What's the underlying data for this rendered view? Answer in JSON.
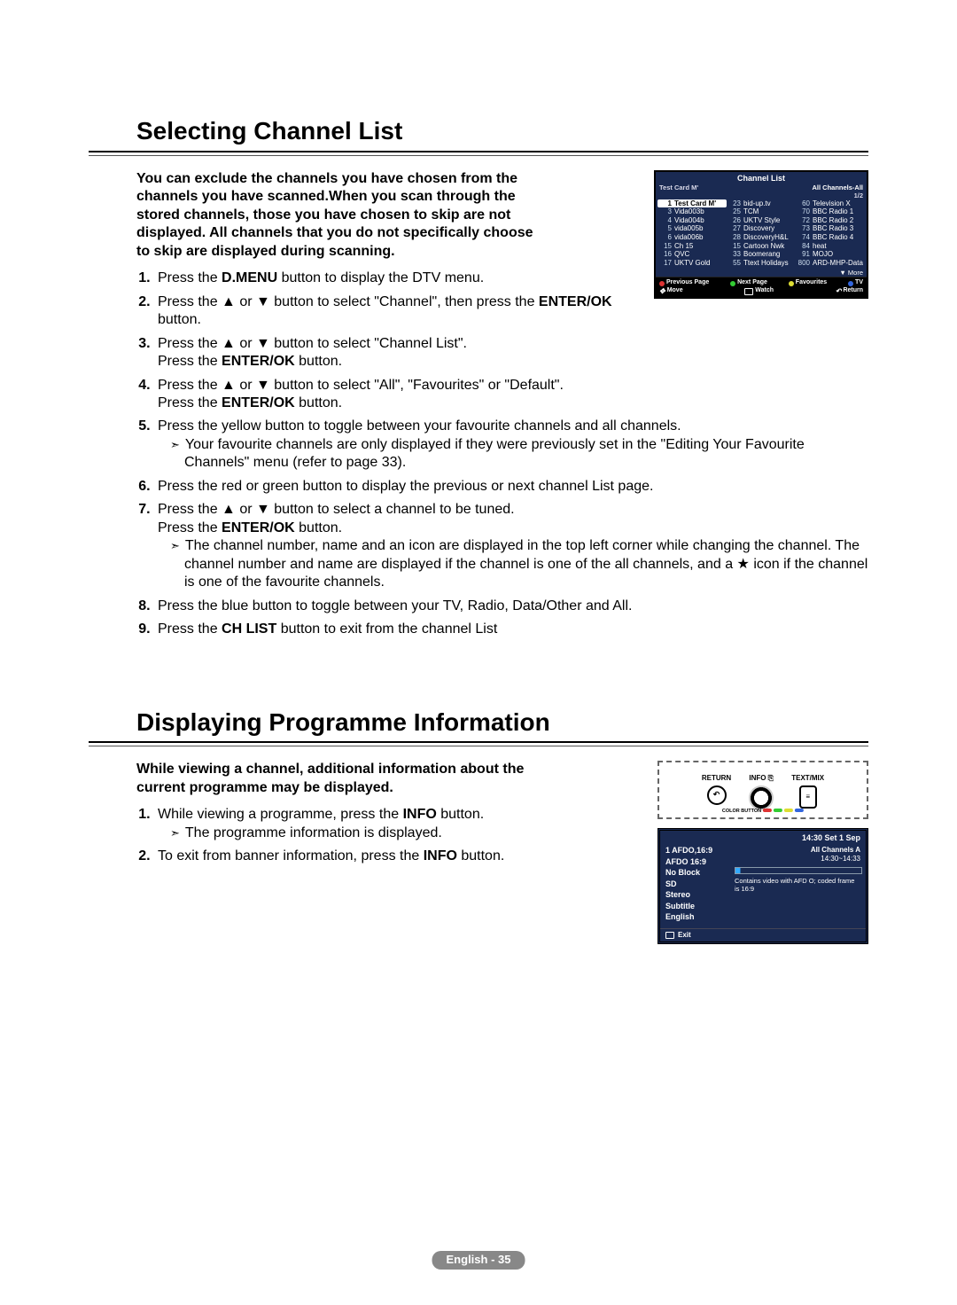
{
  "section1": {
    "title": "Selecting Channel List",
    "intro": "You can exclude the channels you have chosen from the channels you have scanned.When you scan through the stored channels, those you have chosen to skip are not displayed. All channels that you do not specifically choose to skip are displayed during scanning.",
    "steps": {
      "s1a": "Press the ",
      "s1b": "D.MENU",
      "s1c": " button to display the DTV menu.",
      "s2a": "Press the ▲ or ▼ button to select \"Channel\", then press the ",
      "s2b": "ENTER/OK",
      "s2c": " button.",
      "s3a": "Press the ▲ or ▼ button to select \"Channel List\".",
      "s3b": "Press the ",
      "s3c": "ENTER/OK",
      "s3d": " button.",
      "s4a": "Press the ▲ or ▼ button to select \"All\", \"Favourites\" or \"Default\".",
      "s4b": "Press the ",
      "s4c": "ENTER/OK",
      "s4d": " button.",
      "s5a": "Press the yellow button to toggle between your favourite channels and all channels.",
      "s5sub": "Your favourite channels are only displayed if they were previously set in the \"Editing Your Favourite Channels\" menu (refer to page 33).",
      "s6": "Press the red or green button to display the previous or next channel List page.",
      "s7a": "Press the ▲ or ▼ button to select a channel to be tuned.",
      "s7b": "Press the ",
      "s7c": "ENTER/OK",
      "s7d": " button.",
      "s7sub": "The channel number, name and an icon are displayed in the top left corner while changing the channel. The channel number and name are displayed if the channel is one of the all channels, and a ★ icon if the channel is one of the favourite channels.",
      "s8": "Press the blue button to toggle between your TV, Radio, Data/Other and All.",
      "s9a": "Press the ",
      "s9b": "CH LIST",
      "s9c": " button to exit from the channel List"
    }
  },
  "osd": {
    "title": "Channel List",
    "subLeft": "Test Card M'",
    "subRight": "All Channels-All",
    "page": "1/2",
    "col1": [
      {
        "n": "1",
        "name": "Test Card M'",
        "hl": true
      },
      {
        "n": "3",
        "name": "Vida003b"
      },
      {
        "n": "4",
        "name": "Vida004b"
      },
      {
        "n": "5",
        "name": "vida005b"
      },
      {
        "n": "6",
        "name": "vida006b"
      },
      {
        "n": "15",
        "name": "Ch 15"
      },
      {
        "n": "16",
        "name": "QVC"
      },
      {
        "n": "17",
        "name": "UKTV Gold"
      }
    ],
    "col2": [
      {
        "n": "23",
        "name": "bid-up.tv"
      },
      {
        "n": "25",
        "name": "TCM"
      },
      {
        "n": "26",
        "name": "UKTV Style"
      },
      {
        "n": "27",
        "name": "Discovery"
      },
      {
        "n": "28",
        "name": "DiscoveryH&L"
      },
      {
        "n": "15",
        "name": "Cartoon Nwk"
      },
      {
        "n": "33",
        "name": "Boomerang"
      },
      {
        "n": "55",
        "name": "Ttext Holidays"
      }
    ],
    "col3": [
      {
        "n": "60",
        "name": "Television X"
      },
      {
        "n": "70",
        "name": "BBC Radio 1"
      },
      {
        "n": "72",
        "name": "BBC Radio 2"
      },
      {
        "n": "73",
        "name": "BBC Radio 3"
      },
      {
        "n": "74",
        "name": "BBC Radio 4"
      },
      {
        "n": "84",
        "name": "heat"
      },
      {
        "n": "91",
        "name": "MOJO"
      },
      {
        "n": "800",
        "name": "ARD-MHP-Data"
      }
    ],
    "more": "▼ More",
    "legend": {
      "prev": "Previous Page",
      "next": "Next Page",
      "fav": "Favourites",
      "tv": "TV",
      "move": "Move",
      "watch": "Watch",
      "ret": "Return"
    }
  },
  "section2": {
    "title": "Displaying Programme Information",
    "intro": "While viewing a channel, additional information about the current programme may be displayed.",
    "s1a": "While viewing a programme, press the ",
    "s1b": "INFO",
    "s1c": " button.",
    "s1sub": "The programme information is displayed.",
    "s2a": "To exit from banner information, press the ",
    "s2b": "INFO",
    "s2c": " button."
  },
  "remote": {
    "return": "RETURN",
    "info": "INFO",
    "textmix": "TEXT/MIX",
    "colorbtn": "COLOR BUTTON"
  },
  "infoOsd": {
    "time": "14:30 Set 1 Sep",
    "left": [
      "1 AFDO,16:9",
      "AFDO 16:9",
      "No Block",
      "SD",
      "Stereo",
      "Subtitle",
      "English"
    ],
    "rightTitle": "All Channels   A",
    "rightTime": "14:30~14:33",
    "desc": "Contains video with AFD O; coded frame is 16:9",
    "exit": "Exit"
  },
  "footer": "English - 35"
}
